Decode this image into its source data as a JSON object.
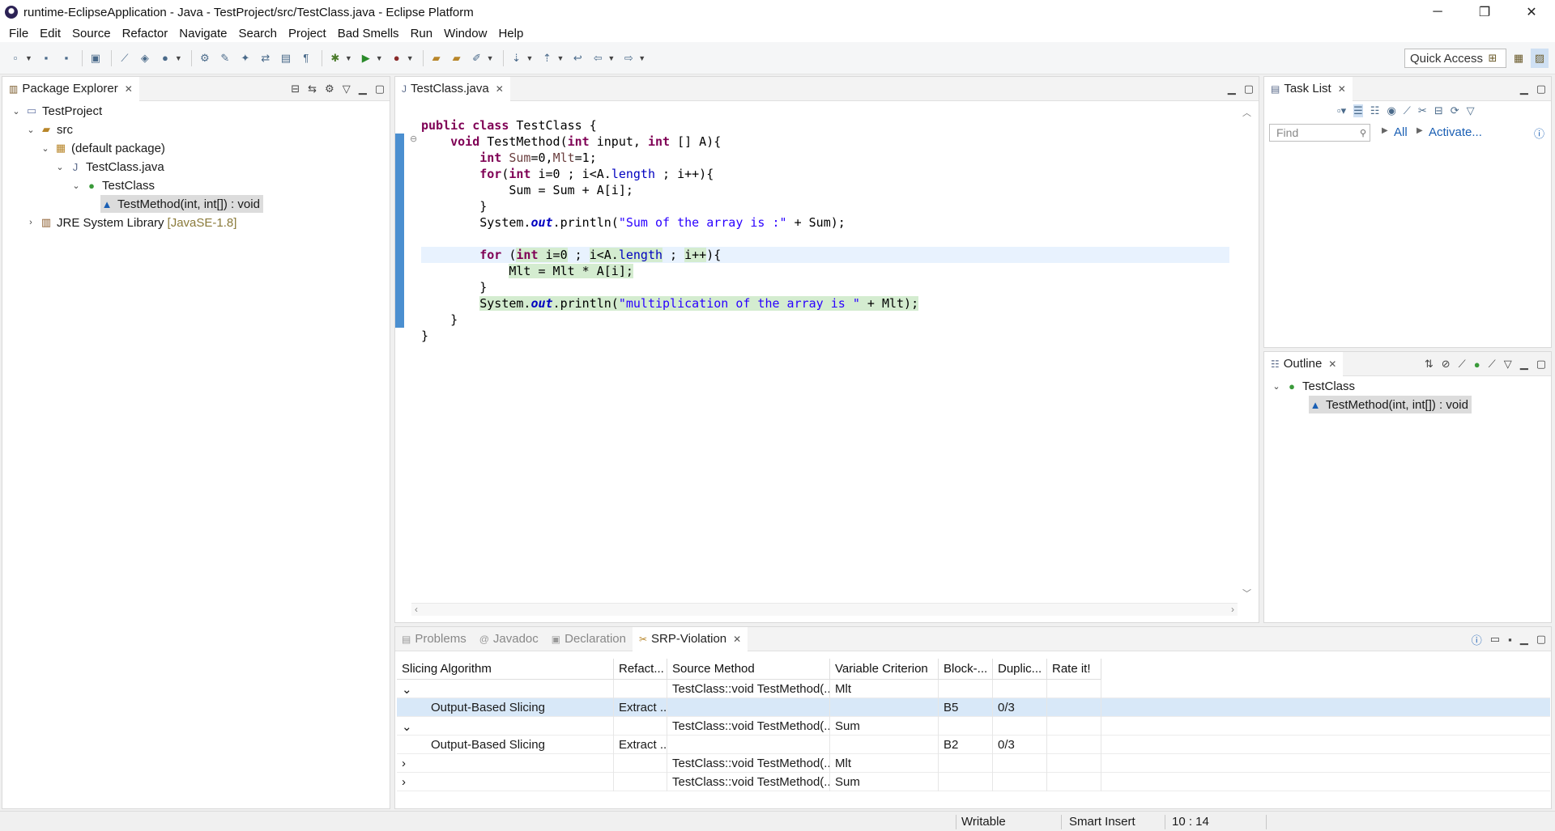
{
  "window": {
    "title": "runtime-EclipseApplication - Java - TestProject/src/TestClass.java - Eclipse Platform",
    "controls": [
      "─",
      "❐",
      "✕"
    ]
  },
  "menu": [
    "File",
    "Edit",
    "Source",
    "Refactor",
    "Navigate",
    "Search",
    "Project",
    "Bad Smells",
    "Run",
    "Window",
    "Help"
  ],
  "toolbar": {
    "quick_access": "Quick Access"
  },
  "package_explorer": {
    "title": "Package Explorer",
    "tree": {
      "project": "TestProject",
      "src": "src",
      "package": "(default package)",
      "file": "TestClass.java",
      "class": "TestClass",
      "method": "TestMethod(int, int[]) : void",
      "jre": "JRE System Library",
      "jre_version": "[JavaSE-1.8]"
    }
  },
  "editor": {
    "tab": "TestClass.java",
    "lines": [
      "public class TestClass {",
      "    void TestMethod(int input, int [] A){",
      "        int Sum=0,Mlt=1;",
      "        for(int i=0 ; i<A.length ; i++){",
      "            Sum = Sum + A[i];",
      "        }",
      "        System.out.println(\"Sum of the array is :\" + Sum);",
      "",
      "        for (int i=0 ; i<A.length ; i++){",
      "            Mlt = Mlt * A[i];",
      "        }",
      "        System.out.println(\"multiplication of the array is \" + Mlt);",
      "    }",
      "}"
    ]
  },
  "task_list": {
    "title": "Task List",
    "find_placeholder": "Find",
    "all": "All",
    "activate": "Activate..."
  },
  "outline": {
    "title": "Outline",
    "class": "TestClass",
    "method": "TestMethod(int, int[]) : void"
  },
  "bottom": {
    "tabs": [
      "Problems",
      "Javadoc",
      "Declaration",
      "SRP-Violation"
    ],
    "columns": [
      "Slicing Algorithm",
      "Refact...",
      "Source Method",
      "Variable Criterion",
      "Block-...",
      "Duplic...",
      "Rate it!"
    ],
    "rows": [
      {
        "twisty": "⌄",
        "algorithm": "",
        "refactoring": "",
        "source": "TestClass::void TestMethod(...",
        "variable": "Mlt",
        "block": "",
        "dup": "",
        "selected": false,
        "child": false
      },
      {
        "twisty": "",
        "algorithm": "Output-Based Slicing",
        "refactoring": "Extract ...",
        "source": "",
        "variable": "",
        "block": "B5",
        "dup": "0/3",
        "selected": true,
        "child": true
      },
      {
        "twisty": "⌄",
        "algorithm": "",
        "refactoring": "",
        "source": "TestClass::void TestMethod(...",
        "variable": "Sum",
        "block": "",
        "dup": "",
        "selected": false,
        "child": false
      },
      {
        "twisty": "",
        "algorithm": "Output-Based Slicing",
        "refactoring": "Extract ...",
        "source": "",
        "variable": "",
        "block": "B2",
        "dup": "0/3",
        "selected": false,
        "child": true
      },
      {
        "twisty": "›",
        "algorithm": "",
        "refactoring": "",
        "source": "TestClass::void TestMethod(...",
        "variable": "Mlt",
        "block": "",
        "dup": "",
        "selected": false,
        "child": false
      },
      {
        "twisty": "›",
        "algorithm": "",
        "refactoring": "",
        "source": "TestClass::void TestMethod(...",
        "variable": "Sum",
        "block": "",
        "dup": "",
        "selected": false,
        "child": false
      }
    ]
  },
  "status": {
    "writable": "Writable",
    "insert_mode": "Smart Insert",
    "position": "10 : 14"
  },
  "colors": {
    "keyword": "#7f0055",
    "string": "#2a00ff",
    "highlight": "#d4ecd0",
    "selection": "#d8e8f8",
    "change_bar": "#4b8fd0"
  }
}
